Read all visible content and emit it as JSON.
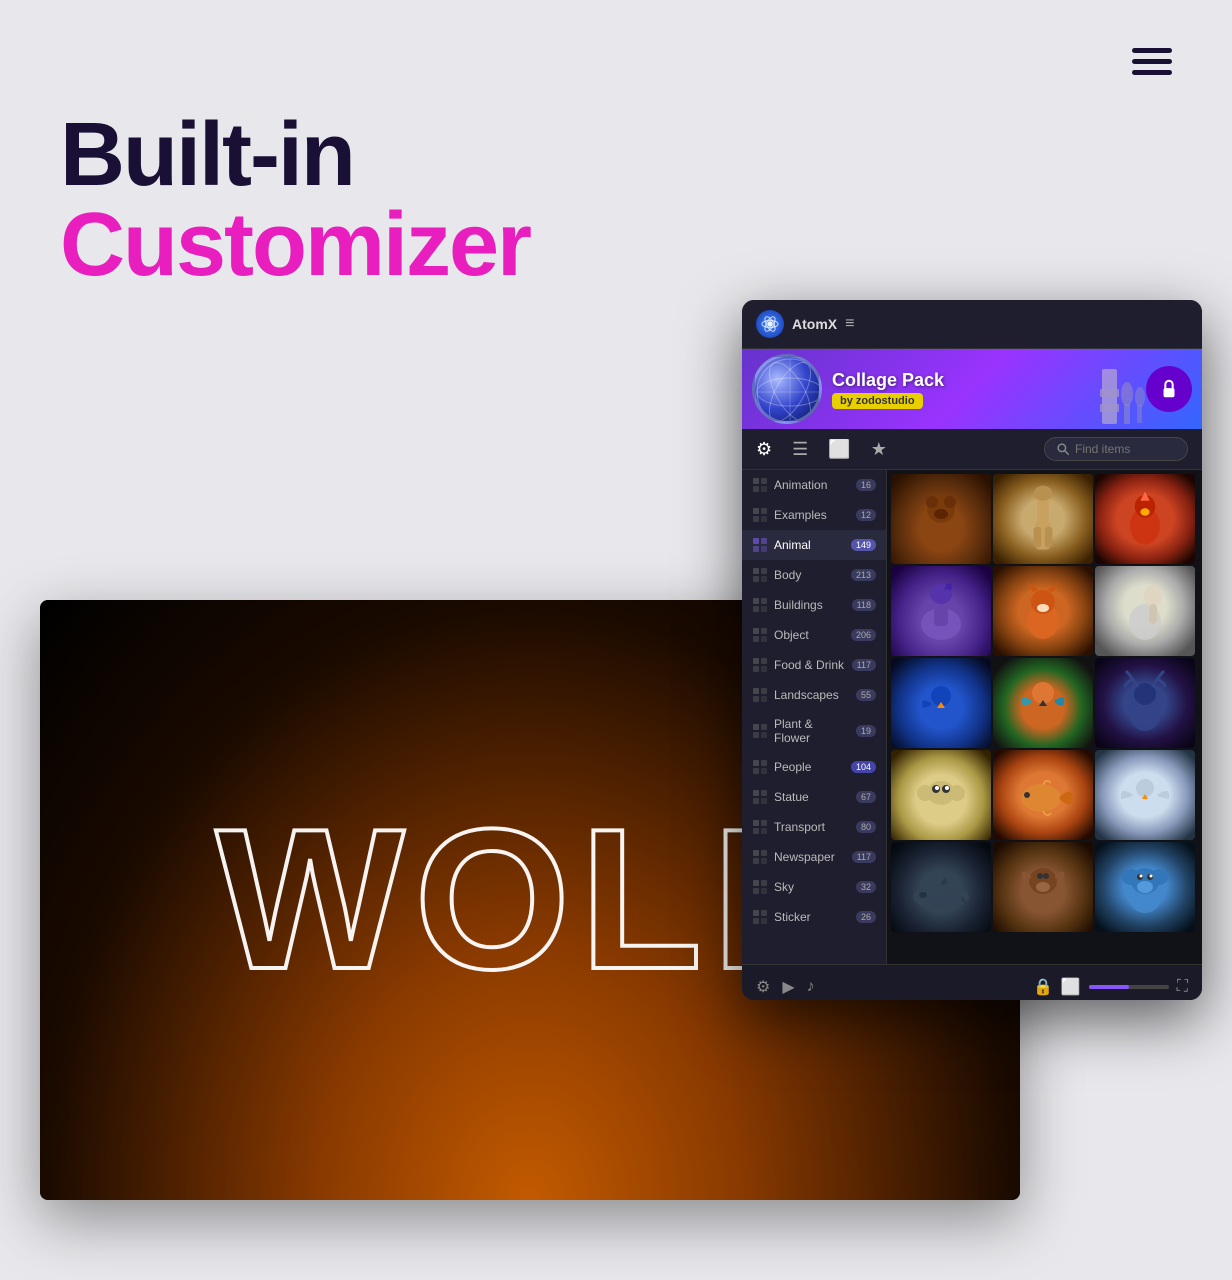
{
  "page": {
    "background": "#e8e8ec",
    "title": "Built-in Customizer"
  },
  "header": {
    "hamburger_lines": 3
  },
  "headline": {
    "line1": "Built-in",
    "line2": "Customizer"
  },
  "panel": {
    "title": "AtomX",
    "menu_icon": "≡",
    "banner": {
      "title": "Collage Pack",
      "subtitle": "by zodostudio",
      "cart_icon": "🔒"
    },
    "search_placeholder": "Find items",
    "categories": [
      {
        "name": "Animation",
        "count": "16",
        "active": false
      },
      {
        "name": "Examples",
        "count": "12",
        "active": false
      },
      {
        "name": "Animal",
        "count": "149",
        "active": true
      },
      {
        "name": "Body",
        "count": "213",
        "active": false
      },
      {
        "name": "Buildings",
        "count": "118",
        "active": false
      },
      {
        "name": "Object",
        "count": "206",
        "active": false
      },
      {
        "name": "Food & Drink",
        "count": "117",
        "active": false
      },
      {
        "name": "Landscapes",
        "count": "55",
        "active": false
      },
      {
        "name": "Plant & Flower",
        "count": "19",
        "active": false
      },
      {
        "name": "People",
        "count": "104",
        "active": false
      },
      {
        "name": "Statue",
        "count": "67",
        "active": false
      },
      {
        "name": "Transport",
        "count": "80",
        "active": false
      },
      {
        "name": "Newspaper",
        "count": "117",
        "active": false
      },
      {
        "name": "Sky",
        "count": "32",
        "active": false
      },
      {
        "name": "Sticker",
        "count": "26",
        "active": false
      }
    ],
    "grid_animals": [
      "bear",
      "giraffe",
      "rooster",
      "horse",
      "fox",
      "ostrich",
      "bird-blue",
      "parrot",
      "deer",
      "frog",
      "fish-gold",
      "bird-white",
      "shark",
      "bull",
      "koala"
    ]
  },
  "canvas": {
    "wolf_text": "WOLF"
  }
}
